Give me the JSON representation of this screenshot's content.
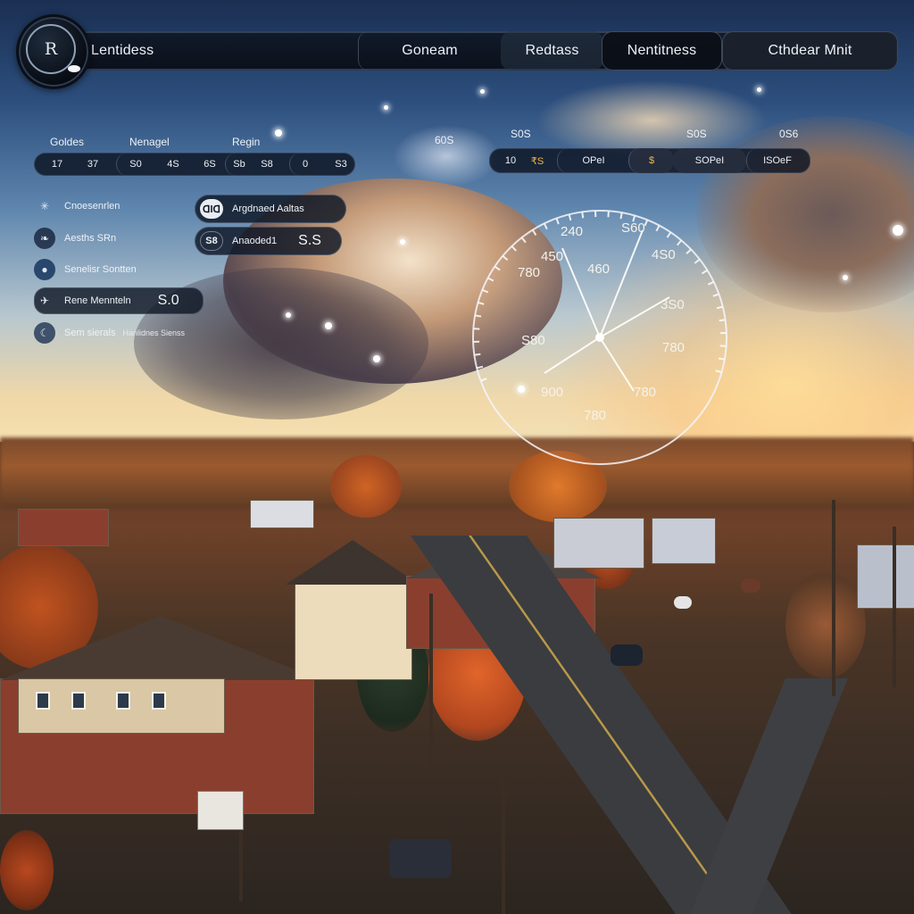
{
  "app": {
    "logo_text": "R"
  },
  "nav": {
    "items": [
      {
        "label": "Lentidess"
      },
      {
        "label": "Goneam"
      },
      {
        "label": "Redtass"
      },
      {
        "label": "Nentitness"
      },
      {
        "label": "Cthdear Mnit"
      }
    ]
  },
  "stats_left": {
    "labels": [
      "Goldes",
      "Nenagel",
      "Regin"
    ],
    "values": [
      "17",
      "37",
      "S0",
      "4S",
      "6S",
      "Sb",
      "S8",
      "0",
      "S3"
    ]
  },
  "stats_right": {
    "labels": [
      "60S",
      "S0S",
      "S0S",
      "0S6"
    ],
    "values": [
      "10",
      "₹S",
      "OPeI",
      "$",
      "SOPeI",
      "ISOeF"
    ]
  },
  "sidebar": {
    "items": [
      {
        "label": "Cnoesenrlen",
        "icon": "sparkle-icon"
      },
      {
        "label": "Aesths SRn",
        "icon": "leaf-icon"
      },
      {
        "label": "Senelisr Sontten",
        "icon": "globe-icon"
      },
      {
        "label": "Rene Mennteln",
        "icon": "plane-icon",
        "value": "S.0"
      },
      {
        "label": "Sem sierals",
        "icon": "moon-icon",
        "extra": "Hanlidnes Sienss"
      }
    ]
  },
  "cards": [
    {
      "badge": "ᗡlᗡ",
      "label": "Argdnaed Aaltas"
    },
    {
      "badge": "S8",
      "label": "Anaoded1",
      "value": "S.S"
    }
  ],
  "dial": {
    "labels": [
      "240",
      "S60",
      "450",
      "460",
      "4S0",
      "780",
      "3S0",
      "S80",
      "780",
      "900",
      "780",
      "780"
    ]
  }
}
